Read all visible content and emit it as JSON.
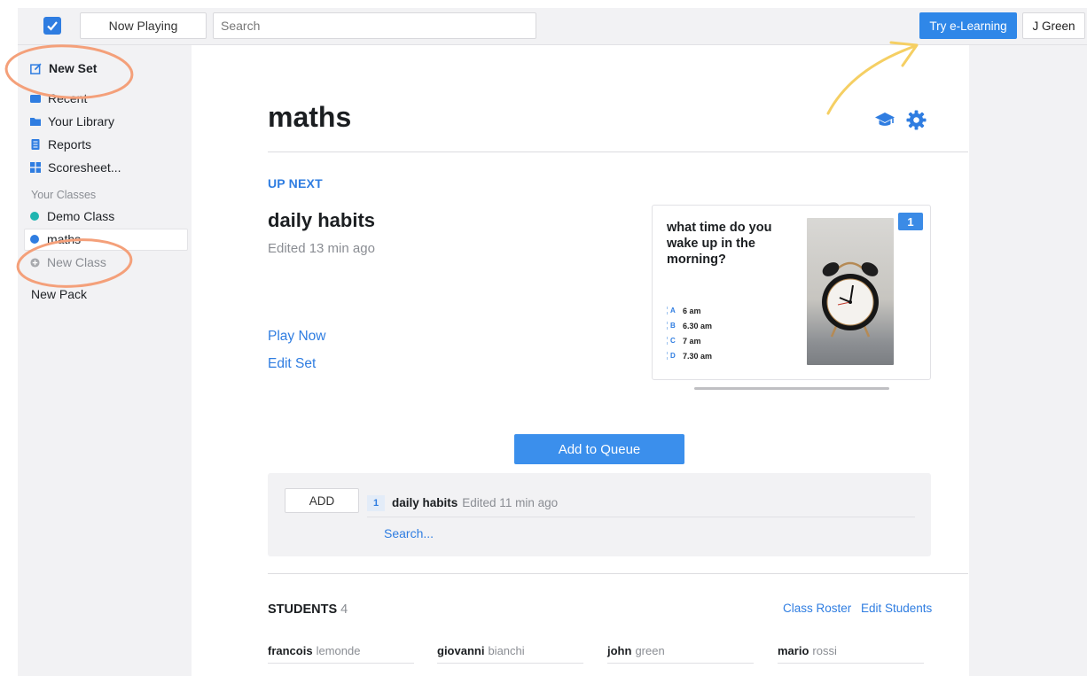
{
  "topbar": {
    "now_playing": "Now Playing",
    "search_placeholder": "Search",
    "try_label": "Try e-Learning",
    "user_label": "J Green"
  },
  "sidebar": {
    "new_set": "New Set",
    "recent": "Recent",
    "library": "Your Library",
    "reports": "Reports",
    "scoresheet": "Scoresheet...",
    "classes_header": "Your Classes",
    "classes": [
      "Demo Class",
      "maths"
    ],
    "new_class": "New Class",
    "new_pack": "New Pack"
  },
  "main": {
    "title": "maths",
    "up_next": "UP NEXT",
    "set_name": "daily habits",
    "edited": "Edited 13 min ago",
    "play_now": "Play Now",
    "edit_set": "Edit Set",
    "card": {
      "question": "what time do you wake up in the morning?",
      "number": "1",
      "answers": [
        {
          "letter": "A",
          "text": "6 am"
        },
        {
          "letter": "B",
          "text": "6.30 am"
        },
        {
          "letter": "C",
          "text": "7 am"
        },
        {
          "letter": "D",
          "text": "7.30 am"
        }
      ]
    },
    "add_queue": "Add to Queue",
    "queue": {
      "add_label": "ADD",
      "item_num": "1",
      "item_name": "daily habits",
      "item_edited": "Edited 11 min ago",
      "search": "Search..."
    },
    "students": {
      "header": "STUDENTS",
      "count": "4",
      "roster": "Class Roster",
      "edit": "Edit Students",
      "list": [
        {
          "first": "francois",
          "last": "lemonde"
        },
        {
          "first": "giovanni",
          "last": "bianchi"
        },
        {
          "first": "john",
          "last": "green"
        },
        {
          "first": "mario",
          "last": "rossi"
        }
      ]
    }
  },
  "colors": {
    "accent": "#2f7de1",
    "annotation_orange": "#f4a07a",
    "annotation_yellow": "#f5cf63",
    "demo_class_dot": "#1fb5b0",
    "maths_dot": "#2f7de1"
  }
}
